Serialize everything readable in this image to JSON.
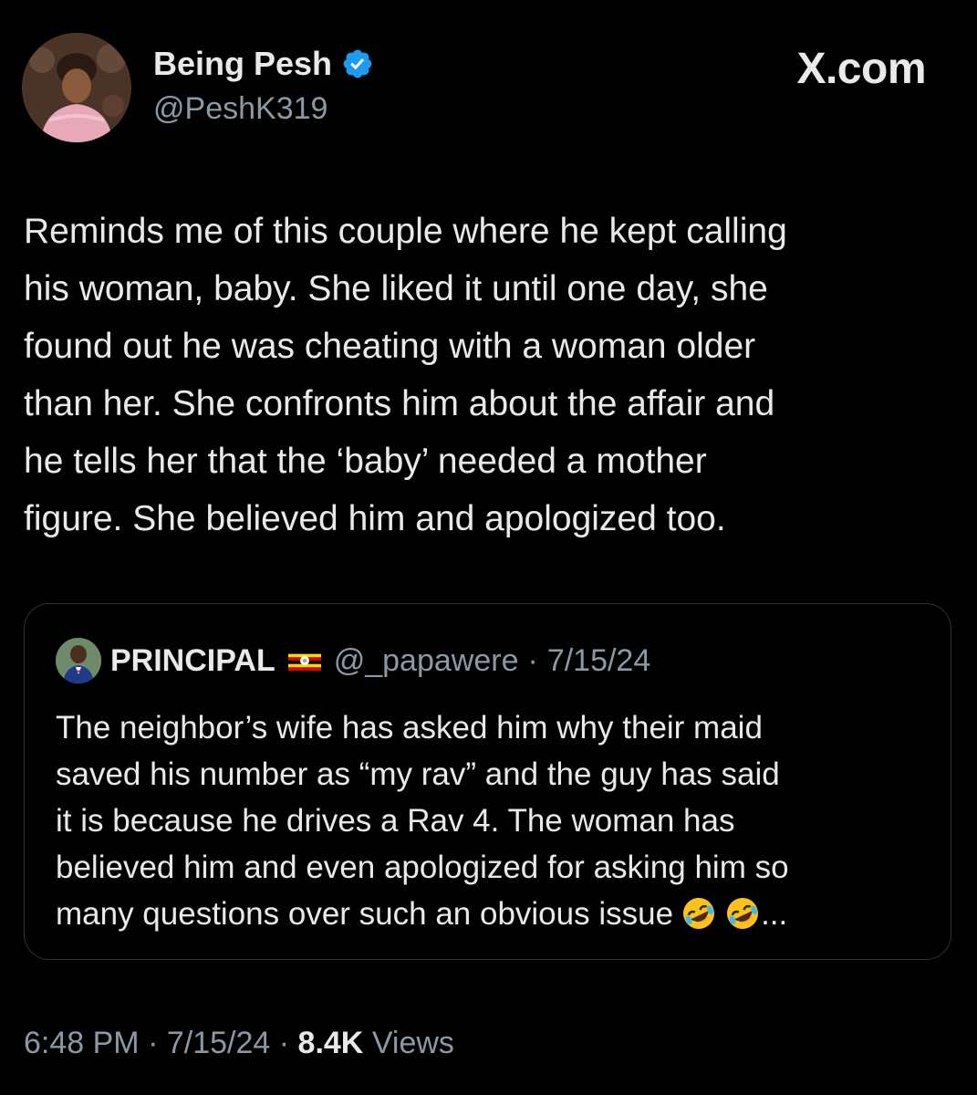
{
  "brand": "X.com",
  "author": {
    "name": "Being Pesh",
    "handle": "@PeshK319"
  },
  "tweet": {
    "text": "Reminds me of this couple where he kept calling\nhis woman, baby. She liked it until one day, she\nfound out he was cheating with a woman older\nthan her. She confronts him about the affair and\nhe tells her that the ‘baby’ needed a mother\nfigure. She believed him and apologized too."
  },
  "quote": {
    "name": "PRINCIPAL",
    "handle": "@_papawere",
    "separator": "·",
    "date": "7/15/24",
    "text": "The neighbor’s wife has asked him why their maid\nsaved his number as “my rav” and the guy has said\nit is because he drives a Rav 4. The woman has\nbelieved him and even apologized for asking him so\nmany questions over such an obvious issue",
    "ellipsis": "..."
  },
  "footer": {
    "time": "6:48 PM",
    "separator": "·",
    "date": "7/15/24",
    "views_count": "8.4K",
    "views_label": "Views"
  },
  "icons": {
    "verified": "verified-badge-icon",
    "flag": "uganda-flag-icon",
    "emoji": "rolling-on-floor-laughing-emoji"
  },
  "colors": {
    "background": "#000000",
    "text": "#e7e9ea",
    "muted": "#8b98a5",
    "verified": "#1d9bf0",
    "border": "#2f3336"
  }
}
